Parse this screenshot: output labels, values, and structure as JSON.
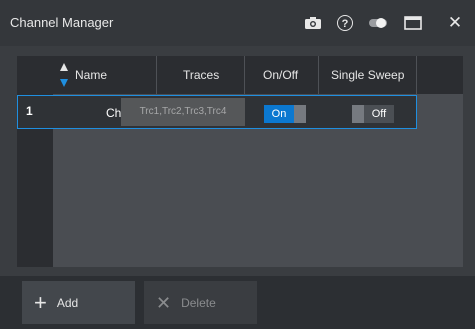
{
  "window": {
    "title": "Channel Manager",
    "icons": [
      "camera-icon",
      "help-icon",
      "toggle-display-icon",
      "maximize-icon",
      "close-icon"
    ]
  },
  "table": {
    "columns": [
      "Name",
      "Traces",
      "On/Off",
      "Single Sweep"
    ],
    "rows": [
      {
        "index": "1",
        "name": "Ch1",
        "traces": "Trc1,Trc2,Trc3,Trc4",
        "on_off": "On",
        "single_sweep": "Off"
      }
    ]
  },
  "buttons": {
    "add": "Add",
    "delete": "Delete"
  },
  "colors": {
    "accent": "#0b78d0",
    "selection_border": "#1f8fe0",
    "background": "#3a3d41"
  }
}
